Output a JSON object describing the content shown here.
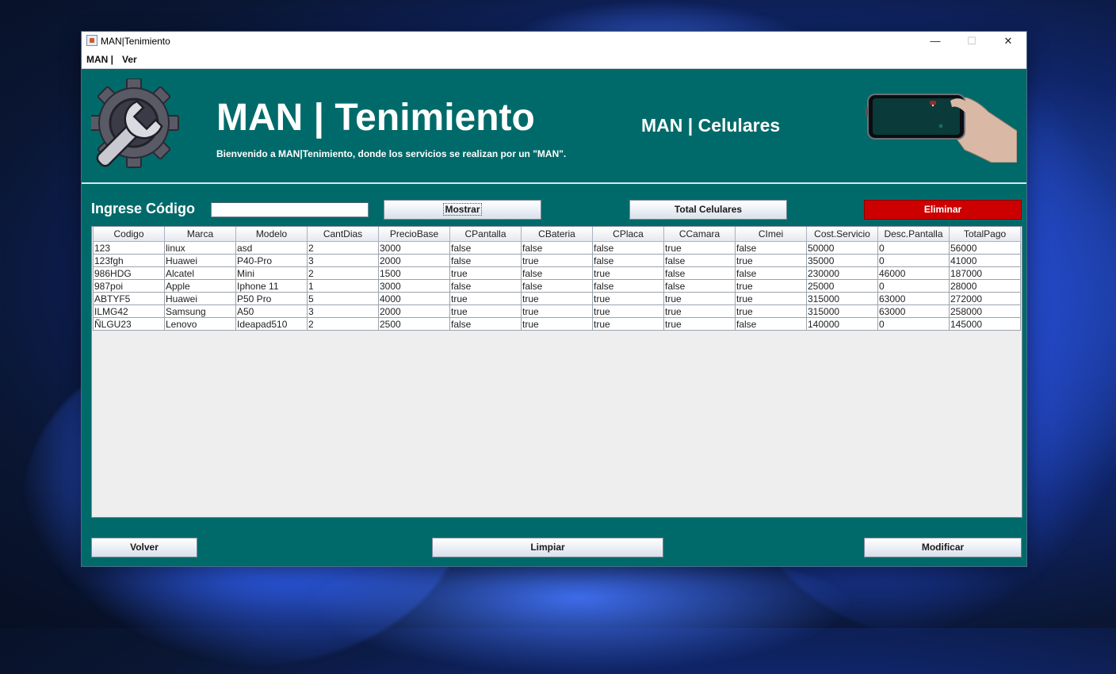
{
  "window": {
    "title": "MAN|Tenimiento",
    "controls": {
      "minimize": "—",
      "maximize": "☐",
      "close": "✕"
    }
  },
  "menu": [
    "MAN |",
    "Ver"
  ],
  "header": {
    "title": "MAN | Tenimiento",
    "welcome": "Bienvenido a MAN|Tenimiento, donde los servicios se realizan por un \"MAN\".",
    "section": "MAN | Celulares",
    "logo_icon": "gear-wrench-icon",
    "phone_image": "hand-holding-phone-image"
  },
  "search": {
    "label": "Ingrese Código",
    "value": ""
  },
  "buttons": {
    "mostrar": "Mostrar",
    "total": "Total Celulares",
    "eliminar": "Eliminar",
    "volver": "Volver",
    "limpiar": "Limpiar",
    "modificar": "Modificar"
  },
  "colors": {
    "panel": "#006a6a",
    "danger": "#cc0000"
  },
  "table": {
    "columns": [
      "Codigo",
      "Marca",
      "Modelo",
      "CantDias",
      "PrecioBase",
      "CPantalla",
      "CBateria",
      "CPlaca",
      "CCamara",
      "CImei",
      "Cost.Servicio",
      "Desc.Pantalla",
      "TotalPago"
    ],
    "rows": [
      [
        "123",
        "linux",
        "asd",
        "2",
        "3000",
        "false",
        "false",
        "false",
        "true",
        "false",
        "50000",
        "0",
        "56000"
      ],
      [
        "123fgh",
        "Huawei",
        "P40-Pro",
        "3",
        "2000",
        "false",
        "true",
        "false",
        "false",
        "true",
        "35000",
        "0",
        "41000"
      ],
      [
        "986HDG",
        "Alcatel",
        "Mini",
        "2",
        "1500",
        "true",
        "false",
        "true",
        "false",
        "false",
        "230000",
        "46000",
        "187000"
      ],
      [
        "987poi",
        "Apple",
        "Iphone 11",
        "1",
        "3000",
        "false",
        "false",
        "false",
        "false",
        "true",
        "25000",
        "0",
        "28000"
      ],
      [
        "ABTYF5",
        "Huawei",
        "P50 Pro",
        "5",
        "4000",
        "true",
        "true",
        "true",
        "true",
        "true",
        "315000",
        "63000",
        "272000"
      ],
      [
        "ILMG42",
        "Samsung",
        "A50",
        "3",
        "2000",
        "true",
        "true",
        "true",
        "true",
        "true",
        "315000",
        "63000",
        "258000"
      ],
      [
        "ÑLGU23",
        "Lenovo",
        "Ideapad510",
        "2",
        "2500",
        "false",
        "true",
        "true",
        "true",
        "false",
        "140000",
        "0",
        "145000"
      ]
    ]
  }
}
